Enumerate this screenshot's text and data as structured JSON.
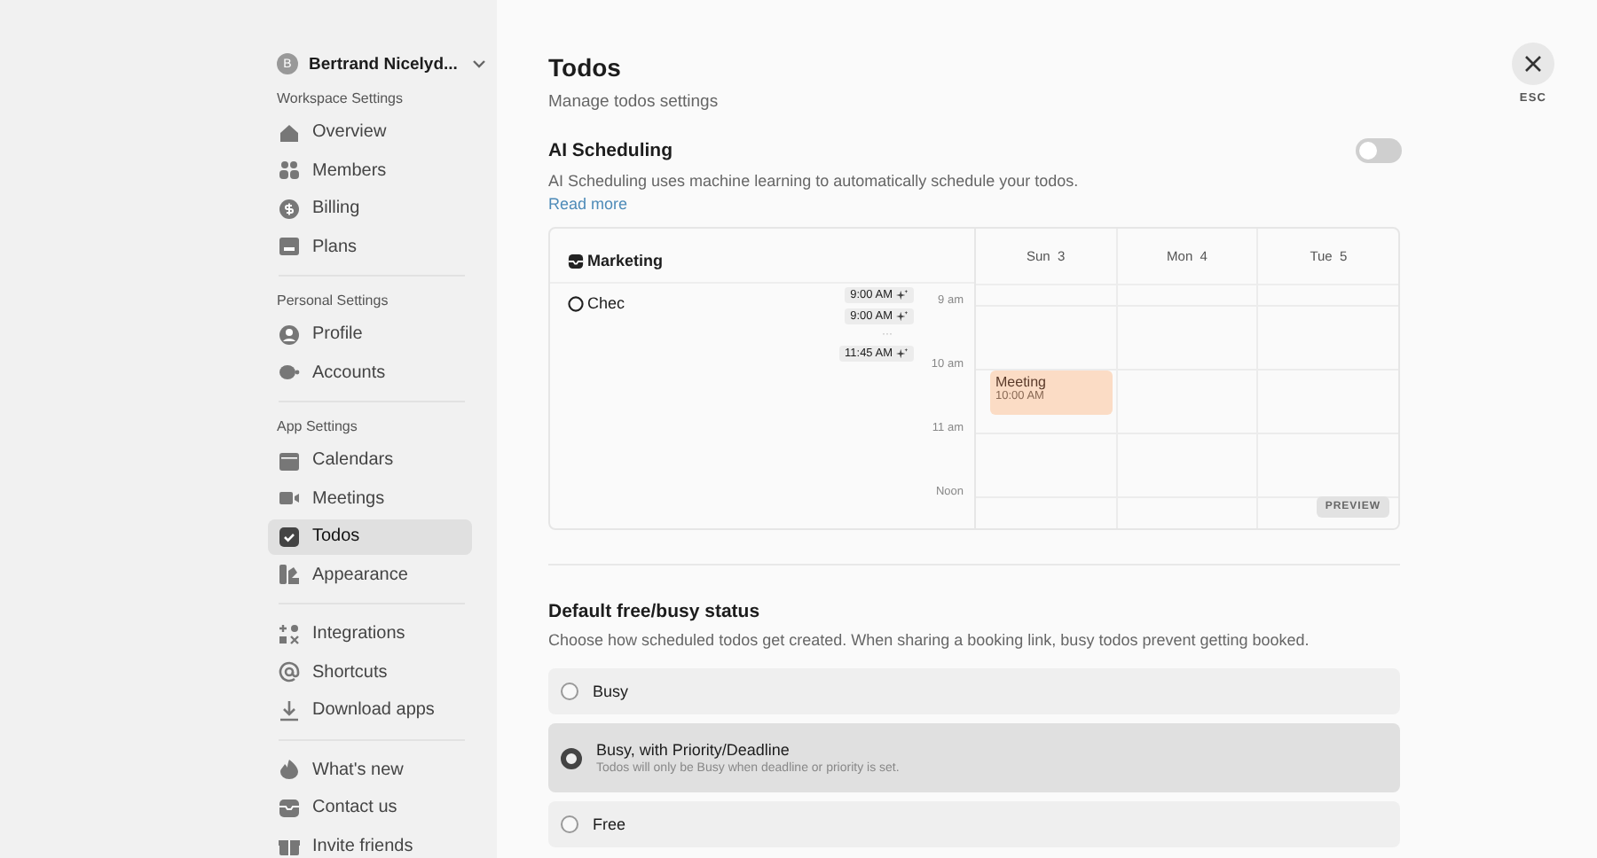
{
  "sidebar": {
    "account": {
      "initial": "B",
      "name": "Bertrand Nicelyd..."
    },
    "groups": [
      {
        "title": "Workspace Settings",
        "items": [
          {
            "label": "Overview",
            "selected": false
          },
          {
            "label": "Members",
            "selected": false
          },
          {
            "label": "Billing",
            "selected": false
          },
          {
            "label": "Plans",
            "selected": false
          }
        ]
      },
      {
        "title": "Personal Settings",
        "items": [
          {
            "label": "Profile",
            "selected": false
          },
          {
            "label": "Accounts",
            "selected": false
          }
        ]
      },
      {
        "title": "App Settings",
        "items": [
          {
            "label": "Calendars",
            "selected": false
          },
          {
            "label": "Meetings",
            "selected": false
          },
          {
            "label": "Todos",
            "selected": true
          },
          {
            "label": "Appearance",
            "selected": false
          }
        ]
      },
      {
        "items": [
          {
            "label": "Integrations",
            "selected": false
          },
          {
            "label": "Shortcuts",
            "selected": false
          },
          {
            "label": "Download apps",
            "selected": false
          }
        ]
      },
      {
        "items": [
          {
            "label": "What's new",
            "selected": false
          },
          {
            "label": "Contact us",
            "selected": false
          },
          {
            "label": "Invite friends",
            "selected": false
          }
        ]
      }
    ]
  },
  "header": {
    "title": "Todos",
    "subtitle": "Manage todos settings",
    "close_hint": "ESC"
  },
  "ai_scheduling": {
    "title": "AI Scheduling",
    "on": false,
    "description": "AI Scheduling uses machine learning to automatically schedule your todos.",
    "link": "Read more"
  },
  "preview": {
    "list_title": "Marketing",
    "todo": "Chec",
    "chips": [
      "9:00 AM",
      "9:00 AM",
      "···",
      "11:45 AM"
    ],
    "hours": [
      "9 am",
      "10 am",
      "11 am",
      "Noon"
    ],
    "days": [
      {
        "name": "Sun",
        "date": "3"
      },
      {
        "name": "Mon",
        "date": "4"
      },
      {
        "name": "Tue",
        "date": "5"
      }
    ],
    "event": {
      "title": "Meeting",
      "time": "10:00 AM"
    },
    "badge": "PREVIEW"
  },
  "busy_status": {
    "title": "Default free/busy status",
    "description": "Choose how scheduled todos get created. When sharing a booking link, busy todos prevent getting booked.",
    "options": [
      {
        "label": "Busy",
        "selected": false
      },
      {
        "label": "Busy, with Priority/Deadline",
        "description": "Todos will only be Busy when deadline or priority is set.",
        "selected": true
      },
      {
        "label": "Free",
        "selected": false
      }
    ]
  }
}
